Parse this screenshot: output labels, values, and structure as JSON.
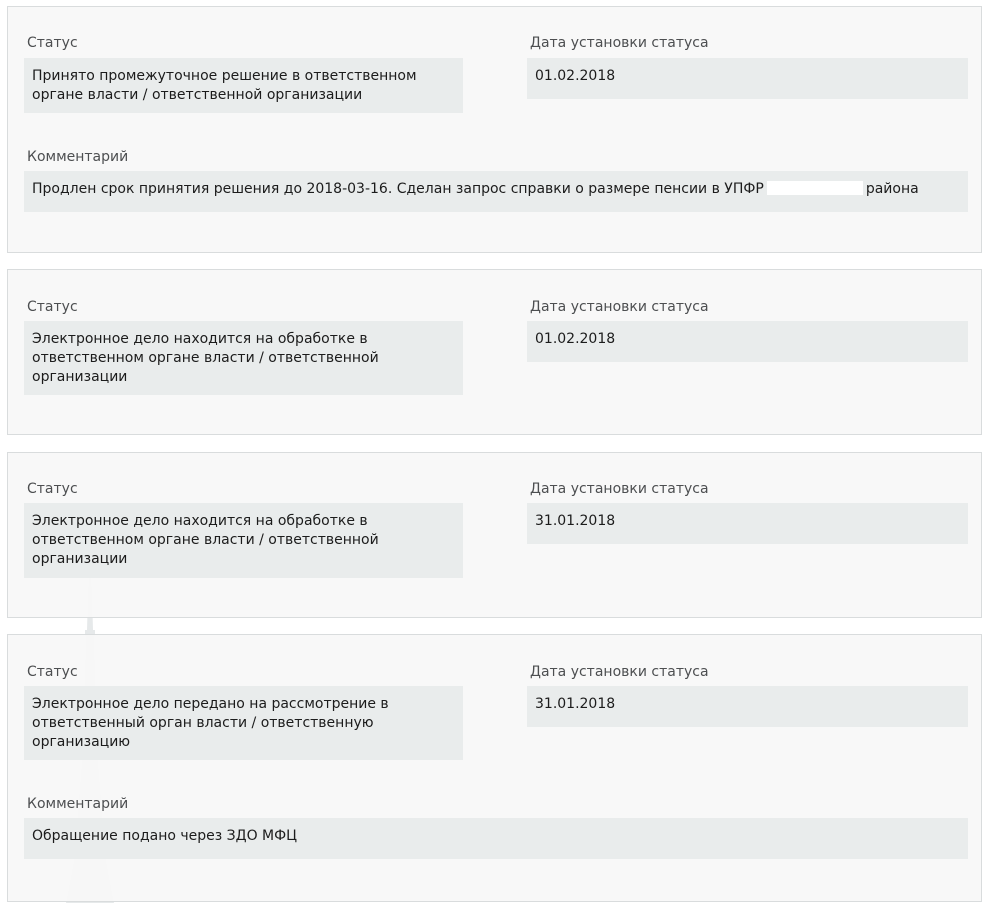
{
  "labels": {
    "status": "Статус",
    "date": "Дата установки статуса",
    "comment": "Комментарий"
  },
  "entries": [
    {
      "status": "Принято промежуточное решение в ответственном органе власти / ответственной организации",
      "date": "01.02.2018",
      "comment_before": "Продлен срок принятия решения до 2018-03-16. Сделан запрос справки о размере пенсии в УПФР",
      "comment_after": "района"
    },
    {
      "status": "Электронное дело находится на обработке в ответственном органе власти / ответственной организации",
      "date": "01.02.2018"
    },
    {
      "status": "Электронное дело находится на обработке в ответственном органе власти / ответственной организации",
      "date": "31.01.2018"
    },
    {
      "status": "Электронное дело передано на рассмотрение в ответственный орган власти / ответственную организацию",
      "date": "31.01.2018",
      "comment": "Обращение подано через ЗДО МФЦ"
    }
  ]
}
